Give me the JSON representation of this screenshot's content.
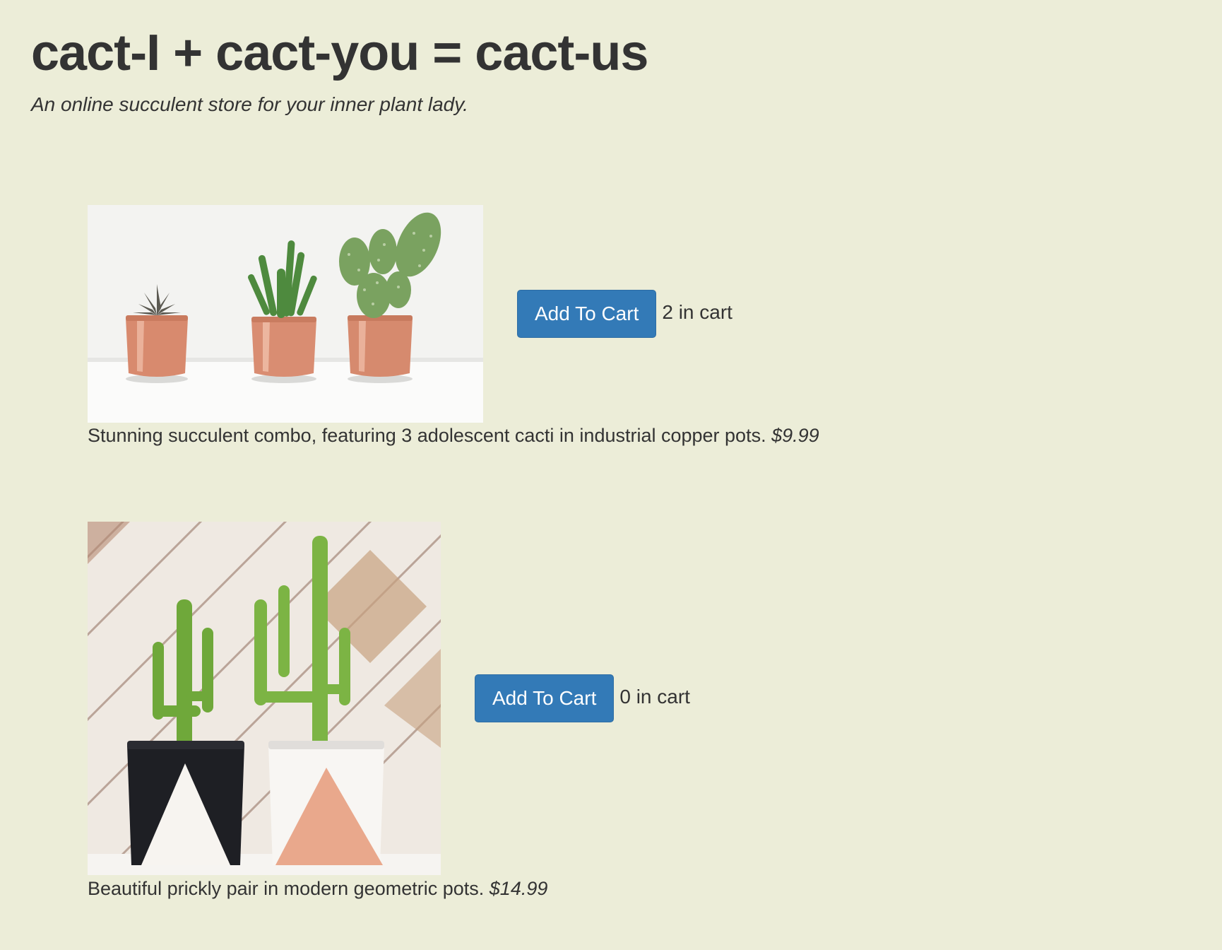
{
  "header": {
    "title": "cact-I + cact-you = cact-us",
    "tagline": "An online succulent store for your inner plant lady."
  },
  "products": [
    {
      "image_alt": "three cacti in copper pots",
      "button_label": "Add To Cart",
      "cart_count_text": "2 in cart",
      "description": "Stunning succulent combo, featuring 3 adolescent cacti in industrial copper pots.",
      "price": "$9.99"
    },
    {
      "image_alt": "two cacti in geometric pots",
      "button_label": "Add To Cart",
      "cart_count_text": "0 in cart",
      "description": "Beautiful prickly pair in modern geometric pots.",
      "price": "$14.99"
    }
  ],
  "colors": {
    "background": "#ecedd8",
    "button": "#337ab7",
    "text": "#333333"
  }
}
